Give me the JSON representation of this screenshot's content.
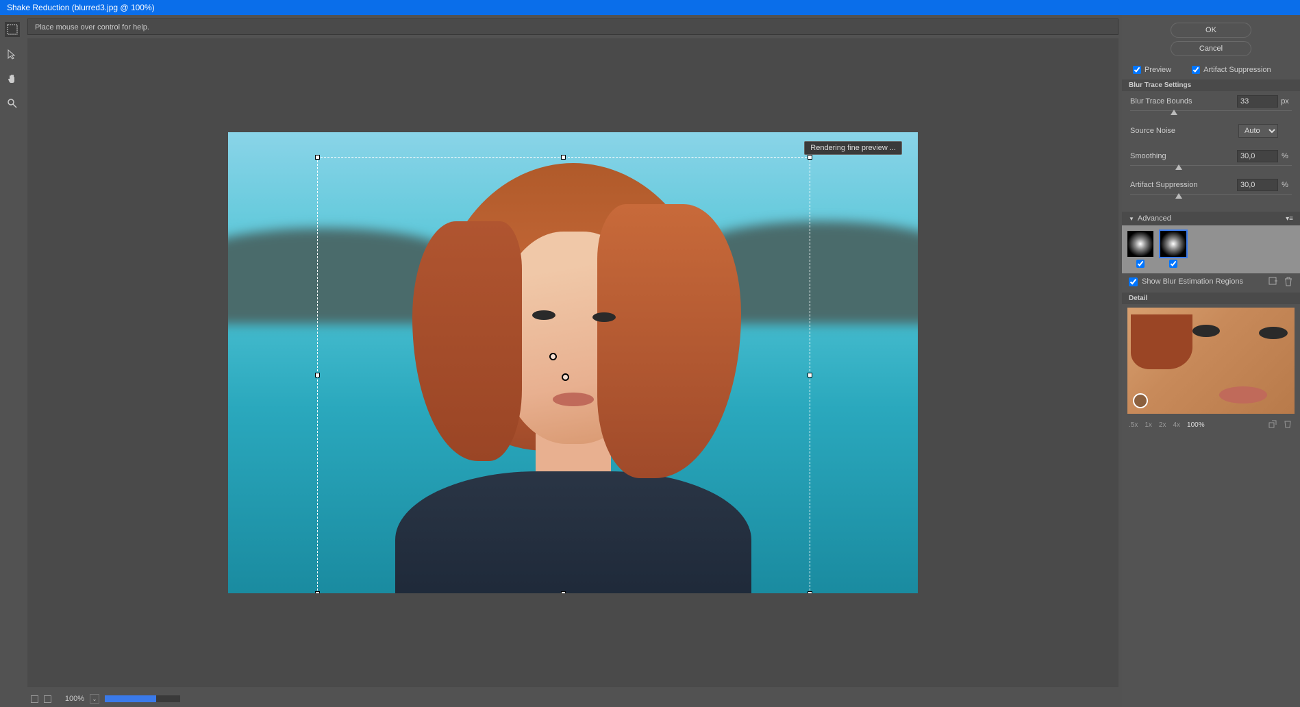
{
  "title": "Shake Reduction (blurred3.jpg @ 100%)",
  "help_text": "Place mouse over control for help.",
  "render_status": "Rendering fine preview ...",
  "bottom": {
    "zoom_value": "100%"
  },
  "buttons": {
    "ok": "OK",
    "cancel": "Cancel"
  },
  "checkboxes": {
    "preview": "Preview",
    "artifact_suppression": "Artifact Suppression",
    "show_regions": "Show Blur Estimation Regions"
  },
  "sections": {
    "blur_trace": "Blur Trace Settings",
    "advanced": "Advanced",
    "detail": "Detail"
  },
  "settings": {
    "blur_trace_bounds": {
      "label": "Blur Trace Bounds",
      "value": "33",
      "unit": "px"
    },
    "source_noise": {
      "label": "Source Noise",
      "value": "Auto"
    },
    "smoothing": {
      "label": "Smoothing",
      "value": "30,0",
      "unit": "%"
    },
    "artifact_supp": {
      "label": "Artifact Suppression",
      "value": "30,0",
      "unit": "%"
    }
  },
  "zoom_levels": [
    ".5x",
    "1x",
    "2x",
    "4x",
    "100%"
  ]
}
